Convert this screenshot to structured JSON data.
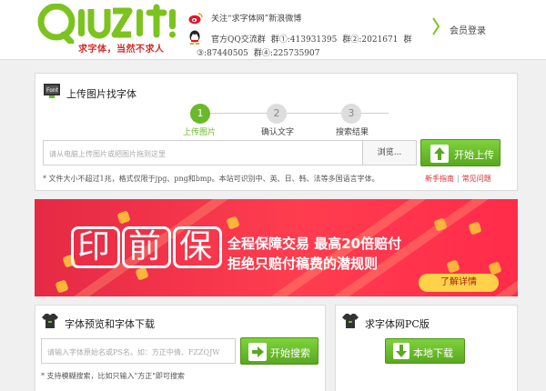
{
  "header": {
    "logo_text": "Qiuziti",
    "slogan": "求字体，当然不求人",
    "weibo_text": "关注“求字体网”新浪微博",
    "qq_line1": [
      "官方QQ交流群",
      "群①:413931395",
      "群②:2021671",
      "群"
    ],
    "qq_line2": [
      "③:87440505",
      "群④:225735907"
    ],
    "member_login": "会员登录"
  },
  "upload": {
    "title": "上传图片找字体",
    "steps": [
      {
        "num": "1",
        "label": "上传图片"
      },
      {
        "num": "2",
        "label": "确认文字"
      },
      {
        "num": "3",
        "label": "搜索结果"
      }
    ],
    "placeholder": "请从电脑上传图片或把图片拖到这里",
    "browse_label": "浏览...",
    "upload_label": "开始上传",
    "note": "* 文件大小不超过1兆，格式仅限于jpg、png和bmp。本站可识别中、英、日、韩、法等多国语言字体。",
    "help_guide": "新手指南",
    "help_sep": "|",
    "help_faq": "常见问题"
  },
  "banner": {
    "big_chars": [
      "印",
      "前",
      "保"
    ],
    "line1": "全程保障交易  最高20倍赔付",
    "line2": "拒绝只赔付稿费的潜规则",
    "details_label": "了解详情"
  },
  "preview": {
    "title": "字体预览和字体下载",
    "placeholder": "请输入字体原始名或PS名。如：方正中倩、FZZQJW",
    "search_label": "开始搜索",
    "note": "* 支持模糊搜索，比如只输入\"方正\"即可搜索"
  },
  "pc": {
    "title": "求字体网PC版",
    "download_label": "本地下载"
  },
  "colors": {
    "brand_green": "#6bb92b",
    "accent_red": "#d92b2b",
    "banner_red": "#ff3d4f",
    "button_yellow": "#ffd24a"
  },
  "icons": [
    "weibo-icon",
    "qq-icon",
    "chevron-right-icon",
    "upload-image-icon",
    "up-arrow-icon",
    "tshirt-icon",
    "down-arrow-icon"
  ]
}
